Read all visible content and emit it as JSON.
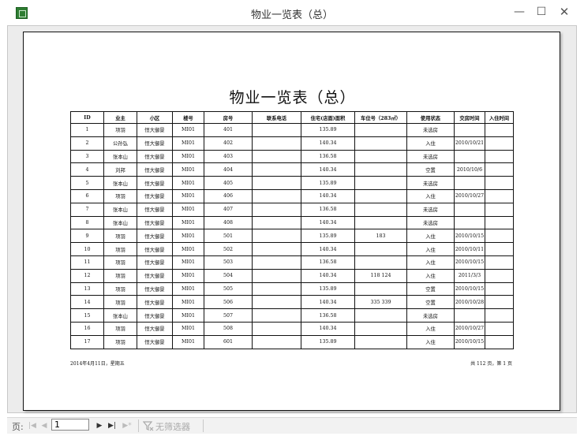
{
  "window": {
    "title": "物业一览表（总）",
    "controls": {
      "minimize": "—",
      "maximize": "☐",
      "close": "✕"
    }
  },
  "report": {
    "title": "物业一览表（总）",
    "columns": [
      "ID",
      "业主",
      "小区",
      "楼号",
      "房号",
      "联系电话",
      "住宅(店面)面积",
      "车位号（283㎡）",
      "使用状态",
      "交房时间",
      "入住时间"
    ],
    "rows": [
      [
        "1",
        "项羽",
        "恒大御景",
        "MI01",
        "401",
        "",
        "135.89",
        "",
        "未选房",
        "",
        ""
      ],
      [
        "2",
        "公孙弘",
        "恒大御景",
        "MI01",
        "402",
        "",
        "140.34",
        "",
        "入住",
        "2010/10/21",
        ""
      ],
      [
        "3",
        "张本山",
        "恒大御景",
        "MI01",
        "403",
        "",
        "136.58",
        "",
        "未选房",
        "",
        ""
      ],
      [
        "4",
        "刘邦",
        "恒大御景",
        "MI01",
        "404",
        "",
        "140.34",
        "",
        "空置",
        "2010/10/6",
        ""
      ],
      [
        "5",
        "张本山",
        "恒大御景",
        "MI01",
        "405",
        "",
        "135.89",
        "",
        "未选房",
        "",
        ""
      ],
      [
        "6",
        "项羽",
        "恒大御景",
        "MI01",
        "406",
        "",
        "140.34",
        "",
        "入住",
        "2010/10/27",
        ""
      ],
      [
        "7",
        "张本山",
        "恒大御景",
        "MI01",
        "407",
        "",
        "136.58",
        "",
        "未选房",
        "",
        ""
      ],
      [
        "8",
        "张本山",
        "恒大御景",
        "MI01",
        "408",
        "",
        "140.34",
        "",
        "未选房",
        "",
        ""
      ],
      [
        "9",
        "项羽",
        "恒大御景",
        "MI01",
        "501",
        "",
        "135.89",
        "183",
        "入住",
        "2010/10/15",
        ""
      ],
      [
        "10",
        "项羽",
        "恒大御景",
        "MI01",
        "502",
        "",
        "140.34",
        "",
        "入住",
        "2010/10/11",
        ""
      ],
      [
        "11",
        "项羽",
        "恒大御景",
        "MI01",
        "503",
        "",
        "136.58",
        "",
        "入住",
        "2010/10/15",
        ""
      ],
      [
        "12",
        "项羽",
        "恒大御景",
        "MI01",
        "504",
        "",
        "140.34",
        "118 124",
        "入住",
        "2011/3/3",
        ""
      ],
      [
        "13",
        "项羽",
        "恒大御景",
        "MI01",
        "505",
        "",
        "135.89",
        "",
        "空置",
        "2010/10/15",
        ""
      ],
      [
        "14",
        "项羽",
        "恒大御景",
        "MI01",
        "506",
        "",
        "140.34",
        "335 339",
        "空置",
        "2010/10/28",
        ""
      ],
      [
        "15",
        "张本山",
        "恒大御景",
        "MI01",
        "507",
        "",
        "136.58",
        "",
        "未选房",
        "",
        ""
      ],
      [
        "16",
        "项羽",
        "恒大御景",
        "MI01",
        "508",
        "",
        "140.34",
        "",
        "入住",
        "2010/10/27",
        ""
      ],
      [
        "17",
        "项羽",
        "恒大御景",
        "MI01",
        "601",
        "",
        "135.89",
        "",
        "入住",
        "2010/10/15",
        ""
      ]
    ],
    "footer_left": "2014年4月11日，星期五",
    "footer_right": "共 112 页，第 1 页"
  },
  "navigation": {
    "label": "页:",
    "page_value": "1",
    "filter_label": "无筛选器",
    "buttons": {
      "first": "|◀",
      "prev": "◀",
      "next": "▶",
      "last": "▶|",
      "new": "▶*"
    }
  }
}
